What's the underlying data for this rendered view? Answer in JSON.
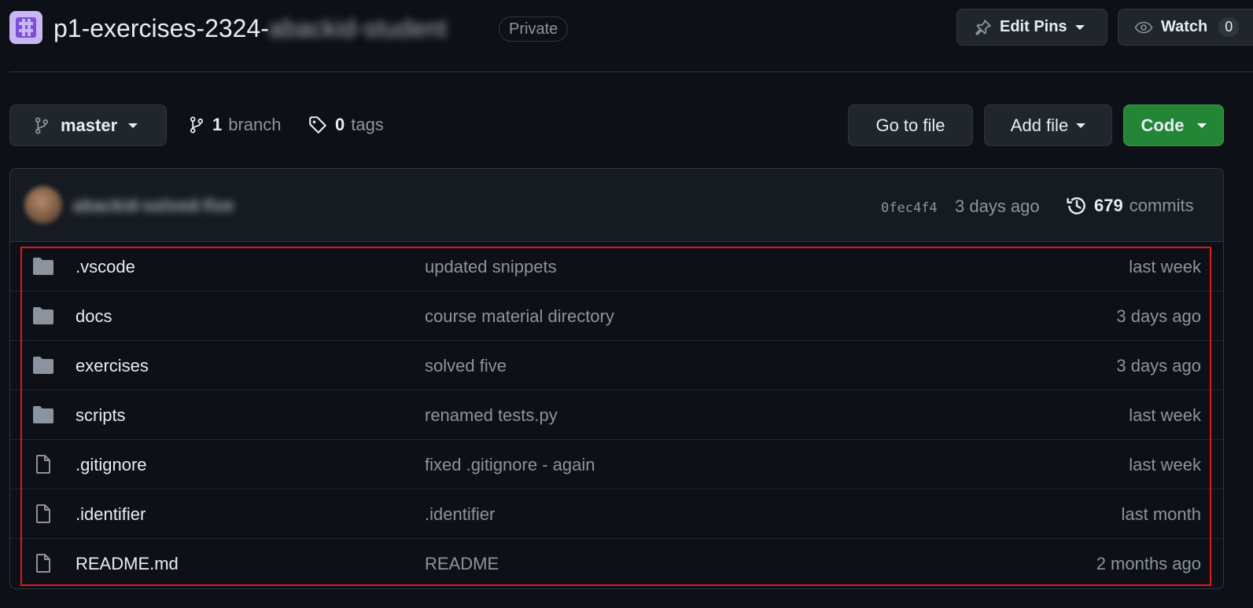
{
  "header": {
    "repo_name_visible": "p1-exercises-2324-",
    "repo_name_hidden": "abackid-student",
    "visibility_badge": "Private",
    "edit_pins_label": "Edit Pins",
    "watch_label": "Watch",
    "watch_count": "0"
  },
  "branch_bar": {
    "current_branch": "master",
    "branch_count": "1",
    "branch_word": "branch",
    "tag_count": "0",
    "tag_word": "tags",
    "go_to_file_label": "Go to file",
    "add_file_label": "Add file",
    "code_label": "Code"
  },
  "latest_commit": {
    "author": "abackid-solved-five",
    "sha": "0fec4f4",
    "time": "3 days ago",
    "commit_count": "679",
    "commit_word": "commits"
  },
  "files": [
    {
      "type": "folder",
      "icon": "folder-icon",
      "name": ".vscode",
      "message": "updated snippets",
      "age": "last week"
    },
    {
      "type": "folder",
      "icon": "folder-icon",
      "name": "docs",
      "message": "course material directory",
      "age": "3 days ago"
    },
    {
      "type": "folder",
      "icon": "folder-icon",
      "name": "exercises",
      "message": "solved five",
      "age": "3 days ago"
    },
    {
      "type": "folder",
      "icon": "folder-icon",
      "name": "scripts",
      "message": "renamed tests.py",
      "age": "last week"
    },
    {
      "type": "file",
      "icon": "file-icon",
      "name": ".gitignore",
      "message": "fixed .gitignore - again",
      "age": "last week"
    },
    {
      "type": "file",
      "icon": "file-icon",
      "name": ".identifier",
      "message": ".identifier",
      "age": "last month"
    },
    {
      "type": "file",
      "icon": "file-icon",
      "name": "README.md",
      "message": "README",
      "age": "2 months ago"
    }
  ],
  "colors": {
    "background": "#0d1117",
    "code_button": "#238636",
    "highlight_box": "#e0161c"
  }
}
